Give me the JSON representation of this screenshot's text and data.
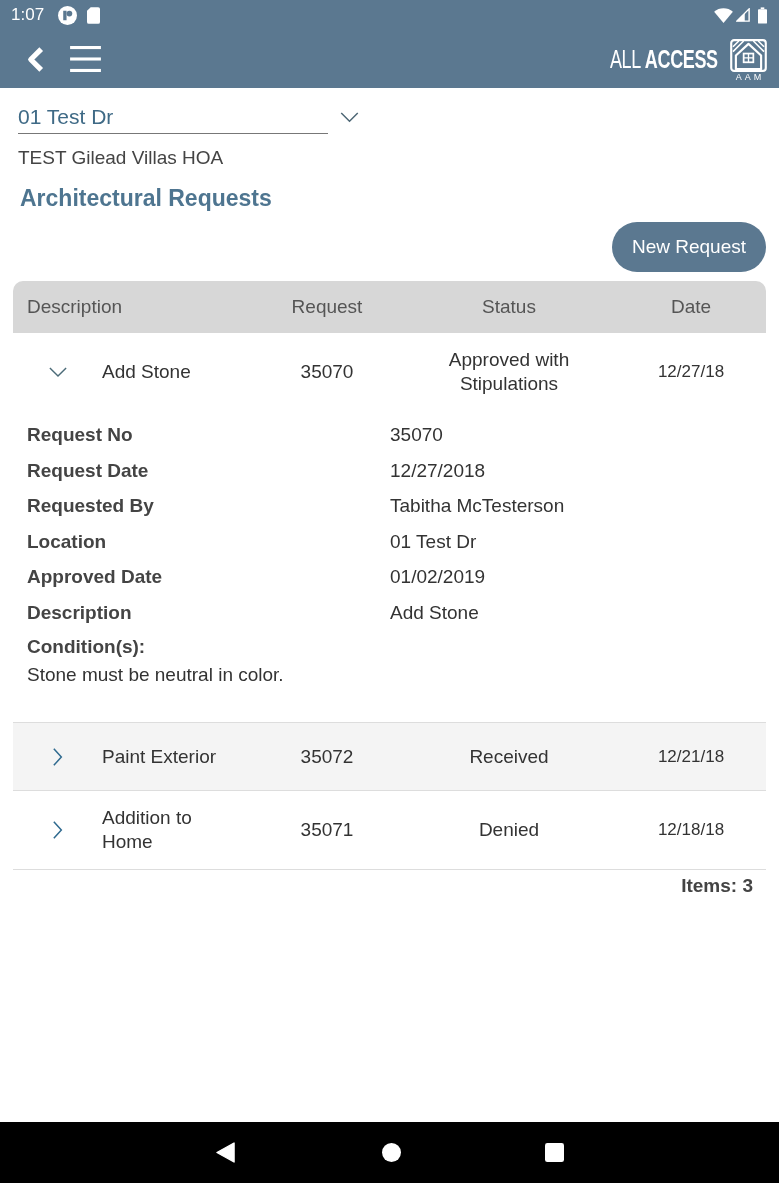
{
  "status_bar": {
    "time": "1:07"
  },
  "app_bar": {
    "logo_text": "ALL **ACCESS**",
    "logo_caption": "AAM"
  },
  "property_select": {
    "value": "01 Test Dr"
  },
  "association": "TEST Gilead Villas HOA",
  "page_title": "Architectural Requests",
  "new_request_button": {
    "label": "New Request"
  },
  "table": {
    "columns": [
      "Description",
      "Request",
      "Status",
      "Date"
    ],
    "rows": [
      {
        "description": "Add Stone",
        "request": "35070",
        "status": "Approved with Stipulations",
        "date": "12/27/18",
        "expanded": true,
        "details": [
          {
            "label": "Request No",
            "value": "35070"
          },
          {
            "label": "Request Date",
            "value": "12/27/2018"
          },
          {
            "label": "Requested By",
            "value": "Tabitha McTesterson"
          },
          {
            "label": "Location",
            "value": "01 Test Dr"
          },
          {
            "label": "Approved Date",
            "value": "01/02/2019"
          },
          {
            "label": "Description",
            "value": "Add Stone"
          }
        ],
        "conditions": {
          "label": "Condition(s):",
          "text": "Stone must be neutral in color."
        }
      },
      {
        "description": "Paint Exterior",
        "request": "35072",
        "status": "Received",
        "date": "12/21/18",
        "expanded": false
      },
      {
        "description": "Addition to Home",
        "request": "35071",
        "status": "Denied",
        "date": "12/18/18",
        "expanded": false
      }
    ]
  },
  "items_count": "Items: 3"
}
